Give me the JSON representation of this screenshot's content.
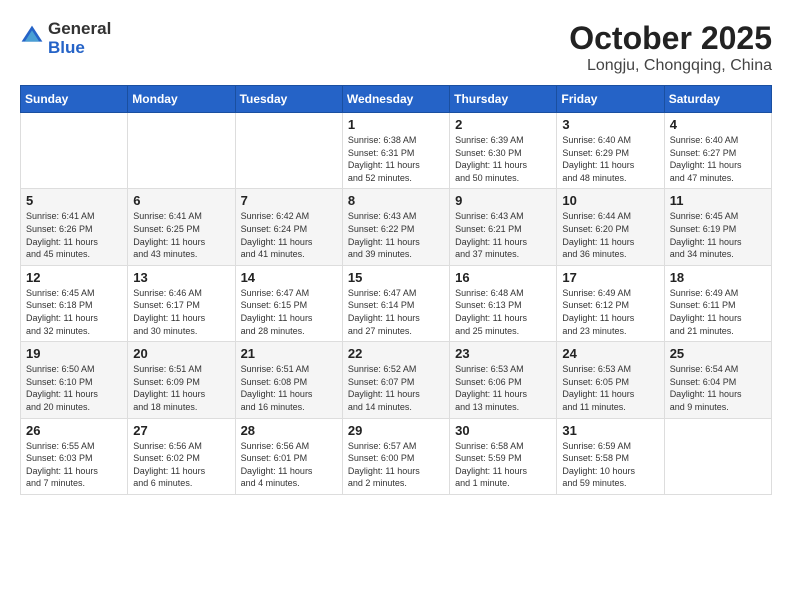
{
  "header": {
    "logo_general": "General",
    "logo_blue": "Blue",
    "month": "October 2025",
    "location": "Longju, Chongqing, China"
  },
  "weekdays": [
    "Sunday",
    "Monday",
    "Tuesday",
    "Wednesday",
    "Thursday",
    "Friday",
    "Saturday"
  ],
  "weeks": [
    [
      {
        "day": "",
        "info": ""
      },
      {
        "day": "",
        "info": ""
      },
      {
        "day": "",
        "info": ""
      },
      {
        "day": "1",
        "info": "Sunrise: 6:38 AM\nSunset: 6:31 PM\nDaylight: 11 hours\nand 52 minutes."
      },
      {
        "day": "2",
        "info": "Sunrise: 6:39 AM\nSunset: 6:30 PM\nDaylight: 11 hours\nand 50 minutes."
      },
      {
        "day": "3",
        "info": "Sunrise: 6:40 AM\nSunset: 6:29 PM\nDaylight: 11 hours\nand 48 minutes."
      },
      {
        "day": "4",
        "info": "Sunrise: 6:40 AM\nSunset: 6:27 PM\nDaylight: 11 hours\nand 47 minutes."
      }
    ],
    [
      {
        "day": "5",
        "info": "Sunrise: 6:41 AM\nSunset: 6:26 PM\nDaylight: 11 hours\nand 45 minutes."
      },
      {
        "day": "6",
        "info": "Sunrise: 6:41 AM\nSunset: 6:25 PM\nDaylight: 11 hours\nand 43 minutes."
      },
      {
        "day": "7",
        "info": "Sunrise: 6:42 AM\nSunset: 6:24 PM\nDaylight: 11 hours\nand 41 minutes."
      },
      {
        "day": "8",
        "info": "Sunrise: 6:43 AM\nSunset: 6:22 PM\nDaylight: 11 hours\nand 39 minutes."
      },
      {
        "day": "9",
        "info": "Sunrise: 6:43 AM\nSunset: 6:21 PM\nDaylight: 11 hours\nand 37 minutes."
      },
      {
        "day": "10",
        "info": "Sunrise: 6:44 AM\nSunset: 6:20 PM\nDaylight: 11 hours\nand 36 minutes."
      },
      {
        "day": "11",
        "info": "Sunrise: 6:45 AM\nSunset: 6:19 PM\nDaylight: 11 hours\nand 34 minutes."
      }
    ],
    [
      {
        "day": "12",
        "info": "Sunrise: 6:45 AM\nSunset: 6:18 PM\nDaylight: 11 hours\nand 32 minutes."
      },
      {
        "day": "13",
        "info": "Sunrise: 6:46 AM\nSunset: 6:17 PM\nDaylight: 11 hours\nand 30 minutes."
      },
      {
        "day": "14",
        "info": "Sunrise: 6:47 AM\nSunset: 6:15 PM\nDaylight: 11 hours\nand 28 minutes."
      },
      {
        "day": "15",
        "info": "Sunrise: 6:47 AM\nSunset: 6:14 PM\nDaylight: 11 hours\nand 27 minutes."
      },
      {
        "day": "16",
        "info": "Sunrise: 6:48 AM\nSunset: 6:13 PM\nDaylight: 11 hours\nand 25 minutes."
      },
      {
        "day": "17",
        "info": "Sunrise: 6:49 AM\nSunset: 6:12 PM\nDaylight: 11 hours\nand 23 minutes."
      },
      {
        "day": "18",
        "info": "Sunrise: 6:49 AM\nSunset: 6:11 PM\nDaylight: 11 hours\nand 21 minutes."
      }
    ],
    [
      {
        "day": "19",
        "info": "Sunrise: 6:50 AM\nSunset: 6:10 PM\nDaylight: 11 hours\nand 20 minutes."
      },
      {
        "day": "20",
        "info": "Sunrise: 6:51 AM\nSunset: 6:09 PM\nDaylight: 11 hours\nand 18 minutes."
      },
      {
        "day": "21",
        "info": "Sunrise: 6:51 AM\nSunset: 6:08 PM\nDaylight: 11 hours\nand 16 minutes."
      },
      {
        "day": "22",
        "info": "Sunrise: 6:52 AM\nSunset: 6:07 PM\nDaylight: 11 hours\nand 14 minutes."
      },
      {
        "day": "23",
        "info": "Sunrise: 6:53 AM\nSunset: 6:06 PM\nDaylight: 11 hours\nand 13 minutes."
      },
      {
        "day": "24",
        "info": "Sunrise: 6:53 AM\nSunset: 6:05 PM\nDaylight: 11 hours\nand 11 minutes."
      },
      {
        "day": "25",
        "info": "Sunrise: 6:54 AM\nSunset: 6:04 PM\nDaylight: 11 hours\nand 9 minutes."
      }
    ],
    [
      {
        "day": "26",
        "info": "Sunrise: 6:55 AM\nSunset: 6:03 PM\nDaylight: 11 hours\nand 7 minutes."
      },
      {
        "day": "27",
        "info": "Sunrise: 6:56 AM\nSunset: 6:02 PM\nDaylight: 11 hours\nand 6 minutes."
      },
      {
        "day": "28",
        "info": "Sunrise: 6:56 AM\nSunset: 6:01 PM\nDaylight: 11 hours\nand 4 minutes."
      },
      {
        "day": "29",
        "info": "Sunrise: 6:57 AM\nSunset: 6:00 PM\nDaylight: 11 hours\nand 2 minutes."
      },
      {
        "day": "30",
        "info": "Sunrise: 6:58 AM\nSunset: 5:59 PM\nDaylight: 11 hours\nand 1 minute."
      },
      {
        "day": "31",
        "info": "Sunrise: 6:59 AM\nSunset: 5:58 PM\nDaylight: 10 hours\nand 59 minutes."
      },
      {
        "day": "",
        "info": ""
      }
    ]
  ]
}
